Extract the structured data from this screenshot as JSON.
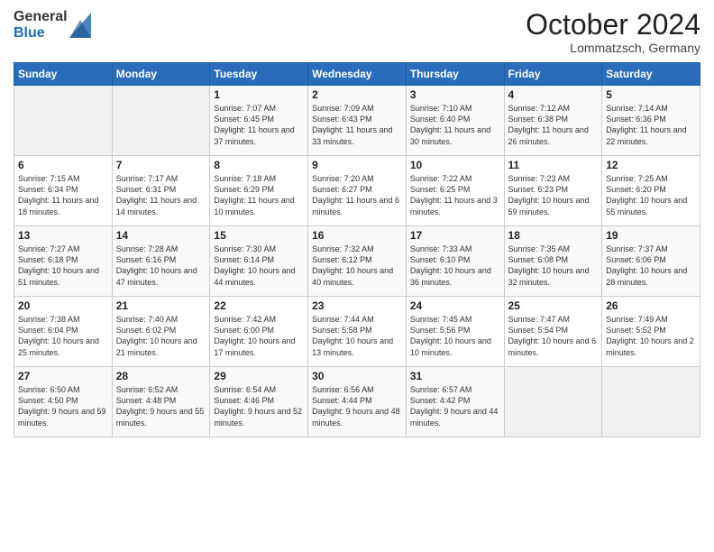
{
  "logo": {
    "general": "General",
    "blue": "Blue"
  },
  "header": {
    "month": "October 2024",
    "location": "Lommatzsch, Germany"
  },
  "weekdays": [
    "Sunday",
    "Monday",
    "Tuesday",
    "Wednesday",
    "Thursday",
    "Friday",
    "Saturday"
  ],
  "weeks": [
    [
      {
        "day": "",
        "sunrise": "",
        "sunset": "",
        "daylight": ""
      },
      {
        "day": "",
        "sunrise": "",
        "sunset": "",
        "daylight": ""
      },
      {
        "day": "1",
        "sunrise": "Sunrise: 7:07 AM",
        "sunset": "Sunset: 6:45 PM",
        "daylight": "Daylight: 11 hours and 37 minutes."
      },
      {
        "day": "2",
        "sunrise": "Sunrise: 7:09 AM",
        "sunset": "Sunset: 6:43 PM",
        "daylight": "Daylight: 11 hours and 33 minutes."
      },
      {
        "day": "3",
        "sunrise": "Sunrise: 7:10 AM",
        "sunset": "Sunset: 6:40 PM",
        "daylight": "Daylight: 11 hours and 30 minutes."
      },
      {
        "day": "4",
        "sunrise": "Sunrise: 7:12 AM",
        "sunset": "Sunset: 6:38 PM",
        "daylight": "Daylight: 11 hours and 26 minutes."
      },
      {
        "day": "5",
        "sunrise": "Sunrise: 7:14 AM",
        "sunset": "Sunset: 6:36 PM",
        "daylight": "Daylight: 11 hours and 22 minutes."
      }
    ],
    [
      {
        "day": "6",
        "sunrise": "Sunrise: 7:15 AM",
        "sunset": "Sunset: 6:34 PM",
        "daylight": "Daylight: 11 hours and 18 minutes."
      },
      {
        "day": "7",
        "sunrise": "Sunrise: 7:17 AM",
        "sunset": "Sunset: 6:31 PM",
        "daylight": "Daylight: 11 hours and 14 minutes."
      },
      {
        "day": "8",
        "sunrise": "Sunrise: 7:18 AM",
        "sunset": "Sunset: 6:29 PM",
        "daylight": "Daylight: 11 hours and 10 minutes."
      },
      {
        "day": "9",
        "sunrise": "Sunrise: 7:20 AM",
        "sunset": "Sunset: 6:27 PM",
        "daylight": "Daylight: 11 hours and 6 minutes."
      },
      {
        "day": "10",
        "sunrise": "Sunrise: 7:22 AM",
        "sunset": "Sunset: 6:25 PM",
        "daylight": "Daylight: 11 hours and 3 minutes."
      },
      {
        "day": "11",
        "sunrise": "Sunrise: 7:23 AM",
        "sunset": "Sunset: 6:23 PM",
        "daylight": "Daylight: 10 hours and 59 minutes."
      },
      {
        "day": "12",
        "sunrise": "Sunrise: 7:25 AM",
        "sunset": "Sunset: 6:20 PM",
        "daylight": "Daylight: 10 hours and 55 minutes."
      }
    ],
    [
      {
        "day": "13",
        "sunrise": "Sunrise: 7:27 AM",
        "sunset": "Sunset: 6:18 PM",
        "daylight": "Daylight: 10 hours and 51 minutes."
      },
      {
        "day": "14",
        "sunrise": "Sunrise: 7:28 AM",
        "sunset": "Sunset: 6:16 PM",
        "daylight": "Daylight: 10 hours and 47 minutes."
      },
      {
        "day": "15",
        "sunrise": "Sunrise: 7:30 AM",
        "sunset": "Sunset: 6:14 PM",
        "daylight": "Daylight: 10 hours and 44 minutes."
      },
      {
        "day": "16",
        "sunrise": "Sunrise: 7:32 AM",
        "sunset": "Sunset: 6:12 PM",
        "daylight": "Daylight: 10 hours and 40 minutes."
      },
      {
        "day": "17",
        "sunrise": "Sunrise: 7:33 AM",
        "sunset": "Sunset: 6:10 PM",
        "daylight": "Daylight: 10 hours and 36 minutes."
      },
      {
        "day": "18",
        "sunrise": "Sunrise: 7:35 AM",
        "sunset": "Sunset: 6:08 PM",
        "daylight": "Daylight: 10 hours and 32 minutes."
      },
      {
        "day": "19",
        "sunrise": "Sunrise: 7:37 AM",
        "sunset": "Sunset: 6:06 PM",
        "daylight": "Daylight: 10 hours and 28 minutes."
      }
    ],
    [
      {
        "day": "20",
        "sunrise": "Sunrise: 7:38 AM",
        "sunset": "Sunset: 6:04 PM",
        "daylight": "Daylight: 10 hours and 25 minutes."
      },
      {
        "day": "21",
        "sunrise": "Sunrise: 7:40 AM",
        "sunset": "Sunset: 6:02 PM",
        "daylight": "Daylight: 10 hours and 21 minutes."
      },
      {
        "day": "22",
        "sunrise": "Sunrise: 7:42 AM",
        "sunset": "Sunset: 6:00 PM",
        "daylight": "Daylight: 10 hours and 17 minutes."
      },
      {
        "day": "23",
        "sunrise": "Sunrise: 7:44 AM",
        "sunset": "Sunset: 5:58 PM",
        "daylight": "Daylight: 10 hours and 13 minutes."
      },
      {
        "day": "24",
        "sunrise": "Sunrise: 7:45 AM",
        "sunset": "Sunset: 5:56 PM",
        "daylight": "Daylight: 10 hours and 10 minutes."
      },
      {
        "day": "25",
        "sunrise": "Sunrise: 7:47 AM",
        "sunset": "Sunset: 5:54 PM",
        "daylight": "Daylight: 10 hours and 6 minutes."
      },
      {
        "day": "26",
        "sunrise": "Sunrise: 7:49 AM",
        "sunset": "Sunset: 5:52 PM",
        "daylight": "Daylight: 10 hours and 2 minutes."
      }
    ],
    [
      {
        "day": "27",
        "sunrise": "Sunrise: 6:50 AM",
        "sunset": "Sunset: 4:50 PM",
        "daylight": "Daylight: 9 hours and 59 minutes."
      },
      {
        "day": "28",
        "sunrise": "Sunrise: 6:52 AM",
        "sunset": "Sunset: 4:48 PM",
        "daylight": "Daylight: 9 hours and 55 minutes."
      },
      {
        "day": "29",
        "sunrise": "Sunrise: 6:54 AM",
        "sunset": "Sunset: 4:46 PM",
        "daylight": "Daylight: 9 hours and 52 minutes."
      },
      {
        "day": "30",
        "sunrise": "Sunrise: 6:56 AM",
        "sunset": "Sunset: 4:44 PM",
        "daylight": "Daylight: 9 hours and 48 minutes."
      },
      {
        "day": "31",
        "sunrise": "Sunrise: 6:57 AM",
        "sunset": "Sunset: 4:42 PM",
        "daylight": "Daylight: 9 hours and 44 minutes."
      },
      {
        "day": "",
        "sunrise": "",
        "sunset": "",
        "daylight": ""
      },
      {
        "day": "",
        "sunrise": "",
        "sunset": "",
        "daylight": ""
      }
    ]
  ]
}
